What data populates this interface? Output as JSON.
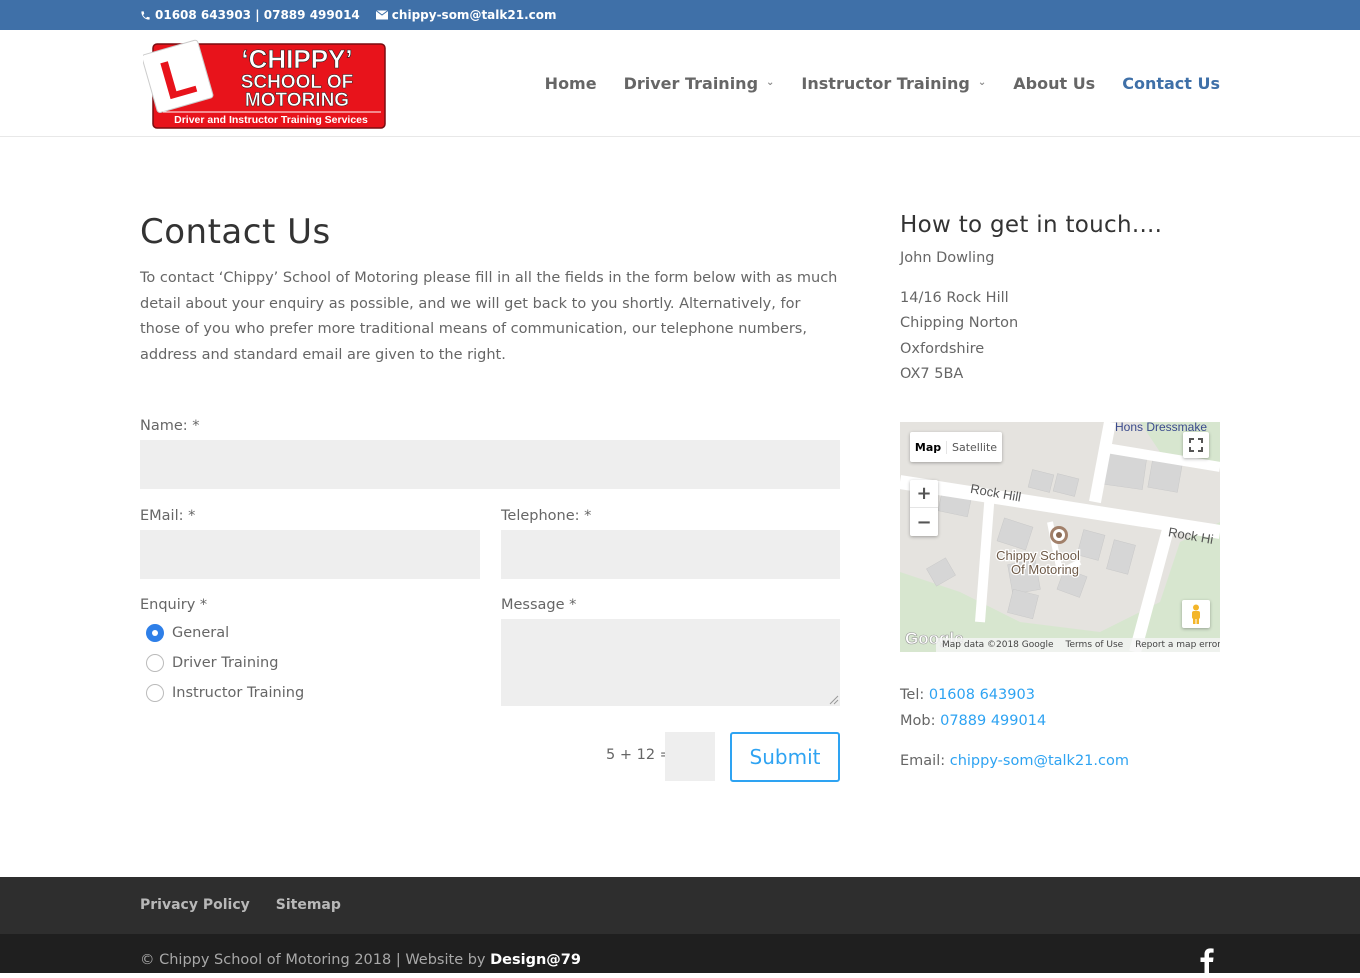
{
  "topbar": {
    "phones": "01608 643903 | 07889 499014",
    "email": "chippy-som@talk21.com"
  },
  "logo": {
    "line1": "‘CHIPPY’",
    "line2": "SCHOOL OF",
    "line3": "MOTORING",
    "tagline": "Driver and Instructor Training Services",
    "plate_letter": "L"
  },
  "nav": {
    "items": [
      {
        "label": "Home",
        "dropdown": false
      },
      {
        "label": "Driver Training",
        "dropdown": true
      },
      {
        "label": "Instructor Training",
        "dropdown": true
      },
      {
        "label": "About Us",
        "dropdown": false
      },
      {
        "label": "Contact Us",
        "dropdown": false,
        "active": true
      }
    ],
    "chevron": "⌄"
  },
  "main": {
    "title": "Contact Us",
    "intro": "To contact ‘Chippy’ School of Motoring please fill in all the fields in the form below with as much detail about your enquiry as possible, and we will get back to you shortly. Alternatively, for those of you who prefer more traditional means of communication, our telephone numbers, address and standard email are given to the right."
  },
  "form": {
    "name_label": "Name: *",
    "email_label": "EMail: *",
    "telephone_label": "Telephone: *",
    "enquiry_label": "Enquiry *",
    "message_label": "Message *",
    "enquiry_options": [
      "General",
      "Driver Training",
      "Instructor Training"
    ],
    "selected_option": "General",
    "captcha": "5 + 12 =",
    "submit_label": "Submit"
  },
  "sidebar": {
    "title": "How to get in touch....",
    "contact_name": "John Dowling",
    "address": [
      "14/16 Rock Hill",
      "Chipping Norton",
      "Oxfordshire",
      "OX7 5BA"
    ],
    "tel_label": "Tel:",
    "tel": "01608 643903",
    "mob_label": "Mob:",
    "mob": "07889 499014",
    "email_label": "Email:",
    "email": "chippy-som@talk21.com"
  },
  "map": {
    "tab_map": "Map",
    "tab_satellite": "Satellite",
    "zoom_in": "+",
    "zoom_out": "−",
    "road1": "Rock Hill",
    "road2": "Rock Hi",
    "poi_top": "Hons Dressmake",
    "marker_line1": "Chippy School",
    "marker_line2": "Of Motoring",
    "google": "Google",
    "attrib_data": "Map data ©2018 Google",
    "attrib_terms": "Terms of Use",
    "attrib_report": "Report a map error"
  },
  "footer": {
    "links": [
      "Privacy Policy",
      "Sitemap"
    ],
    "copyright": "© Chippy School of Motoring 2018 | Website by ",
    "designer": "Design@79"
  },
  "colors": {
    "topbar": "#3f70a8",
    "accent": "#2ea3f2",
    "logo_red": "#e8131b"
  }
}
